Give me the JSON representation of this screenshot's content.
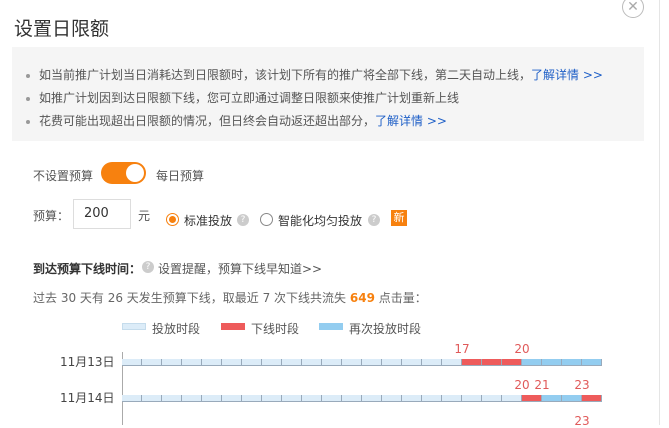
{
  "title": "设置日限额",
  "close_icon": "close-icon",
  "notices": [
    {
      "text": "如当前推广计划当日消耗达到日限额时，该计划下所有的推广将全部下线，第二天自动上线，",
      "link": "了解详情 >>"
    },
    {
      "text": "如推广计划因到达日限额下线，您可立即通过调整日限额来使推广计划重新上线",
      "link": ""
    },
    {
      "text": "花费可能出现超出日限额的情况，但日终会自动返还超出部分，",
      "link": "了解详情 >>"
    }
  ],
  "toggle": {
    "left_label": "不设置预算",
    "right_label": "每日预算",
    "on": true
  },
  "budget": {
    "label": "预算：",
    "value": "200",
    "unit": "元"
  },
  "modes": [
    {
      "label": "标准投放",
      "selected": true
    },
    {
      "label": "智能化均匀投放",
      "selected": false
    }
  ],
  "new_badge": "新",
  "offline_section": {
    "label": "到达预算下线时间：",
    "link": "设置提醒，预算下线早知道>>"
  },
  "summary": {
    "p1": "过去 30 天有 26 天发生预算下线，取最近 7 次下线共流失",
    "clicks": "649",
    "p2": "点击量："
  },
  "legend": [
    {
      "label": "投放时段",
      "color": "#dcecf8"
    },
    {
      "label": "下线时段",
      "color": "#ee5b5b"
    },
    {
      "label": "再次投放时段",
      "color": "#93cdf0"
    }
  ],
  "chart_data": {
    "type": "timeline",
    "hours": 24,
    "rows": [
      {
        "date": "11月13日",
        "segments": [
          {
            "from": 0,
            "to": 17,
            "type": 0
          },
          {
            "from": 17,
            "to": 20,
            "type": 1
          },
          {
            "from": 20,
            "to": 24,
            "type": 2
          }
        ],
        "labels": [
          "17",
          "20"
        ],
        "label_hours": [
          17,
          20
        ]
      },
      {
        "date": "11月14日",
        "segments": [
          {
            "from": 0,
            "to": 20,
            "type": 0
          },
          {
            "from": 20,
            "to": 21,
            "type": 1
          },
          {
            "from": 21,
            "to": 23,
            "type": 2
          },
          {
            "from": 23,
            "to": 24,
            "type": 1
          }
        ],
        "labels": [
          "20",
          "21",
          "23"
        ],
        "label_hours": [
          20,
          21,
          23
        ]
      },
      {
        "date": "",
        "segments": [],
        "labels": [
          "23"
        ],
        "label_hours": [
          23
        ]
      }
    ]
  }
}
